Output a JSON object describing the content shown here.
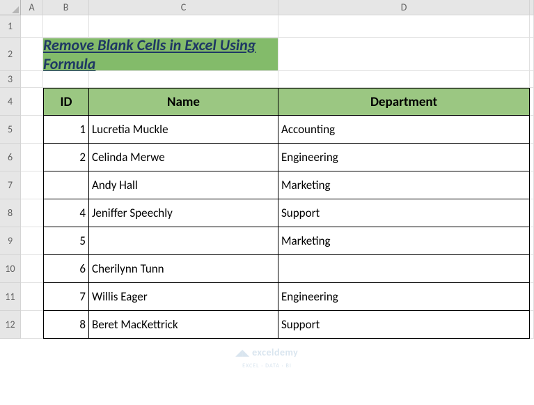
{
  "columns": [
    "A",
    "B",
    "C",
    "D"
  ],
  "rows": [
    "1",
    "2",
    "3",
    "4",
    "5",
    "6",
    "7",
    "8",
    "9",
    "10",
    "11",
    "12"
  ],
  "title": "Remove Blank Cells in Excel Using Formula",
  "headers": {
    "id": "ID",
    "name": "Name",
    "dept": "Department"
  },
  "data": [
    {
      "id": "1",
      "name": "Lucretia Muckle",
      "dept": "Accounting"
    },
    {
      "id": "2",
      "name": "Celinda Merwe",
      "dept": "Engineering"
    },
    {
      "id": "",
      "name": "Andy Hall",
      "dept": "Marketing"
    },
    {
      "id": "4",
      "name": "Jeniffer Speechly",
      "dept": "Support"
    },
    {
      "id": "5",
      "name": "",
      "dept": "Marketing"
    },
    {
      "id": "6",
      "name": "Cherilynn Tunn",
      "dept": ""
    },
    {
      "id": "7",
      "name": "Willis Eager",
      "dept": "Engineering"
    },
    {
      "id": "8",
      "name": "Beret MacKettrick",
      "dept": "Support"
    }
  ],
  "watermark": {
    "brand": "exceldemy",
    "tagline": "EXCEL · DATA · BI"
  }
}
